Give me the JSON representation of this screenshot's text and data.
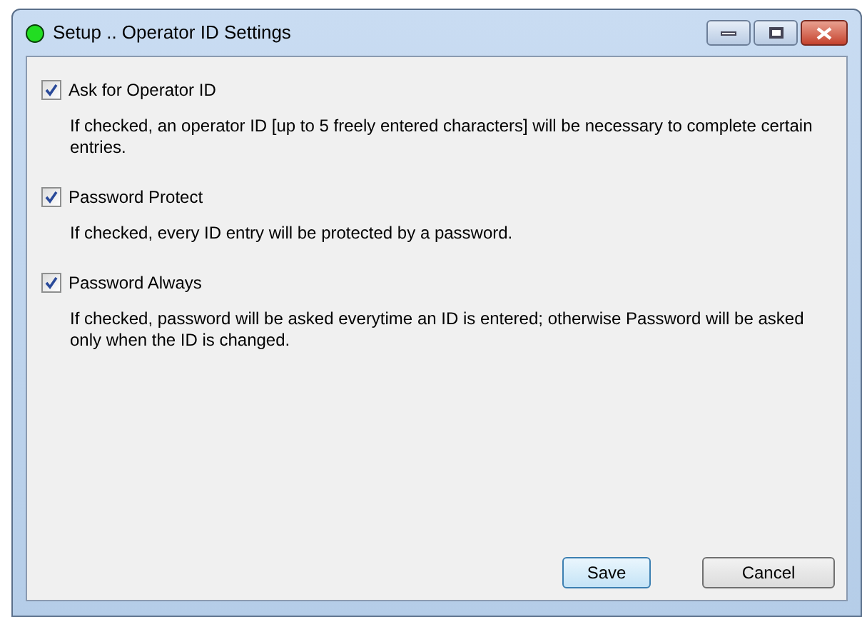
{
  "window": {
    "title": "Setup .. Operator  ID Settings"
  },
  "options": [
    {
      "label": "Ask for Operator ID",
      "checked": true,
      "description": "If checked, an operator ID [up to 5 freely entered characters] will be necessary to complete certain entries."
    },
    {
      "label": "Password Protect",
      "checked": true,
      "description": "If checked, every ID entry will be protected by a password."
    },
    {
      "label": "Password Always",
      "checked": true,
      "description": "If checked, password will be asked everytime an ID is entered; otherwise Password will be asked only when the ID is changed."
    }
  ],
  "buttons": [
    {
      "label": "Save",
      "selected": true
    },
    {
      "label": "Cancel",
      "selected": false
    }
  ]
}
